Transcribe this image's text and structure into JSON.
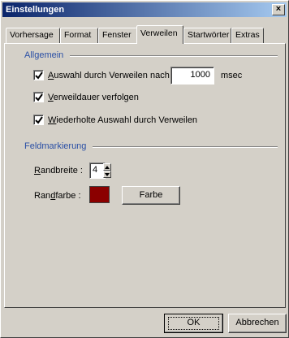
{
  "window": {
    "title": "Einstellungen",
    "close_symbol": "×"
  },
  "tabs": [
    {
      "label": "Vorhersage",
      "active": false
    },
    {
      "label": "Format",
      "active": false
    },
    {
      "label": "Fenster",
      "active": false
    },
    {
      "label": "Verweilen",
      "active": true
    },
    {
      "label": "Startwörter",
      "active": false
    },
    {
      "label": "Extras",
      "active": false
    }
  ],
  "allgemein": {
    "heading": "Allgemein",
    "dwell_select": {
      "label_first": "A",
      "label_rest": "uswahl durch Verweilen nach",
      "value": "1000",
      "unit": "msec",
      "checked": true
    },
    "track_dwell": {
      "label_first": "V",
      "label_rest": "erweildauer verfolgen",
      "checked": true
    },
    "repeat_select": {
      "label_first": "W",
      "label_rest": "iederholte Auswahl durch Verweilen",
      "checked": true
    }
  },
  "feldmarkierung": {
    "heading": "Feldmarkierung",
    "border_width": {
      "label_first": "R",
      "label_rest": "andbreite :",
      "value": "4"
    },
    "border_color": {
      "label_start": "Ran",
      "label_underlined": "d",
      "label_end": "farbe :",
      "color": "#8b0000",
      "button_label": "Farbe"
    }
  },
  "footer": {
    "ok_label": "OK",
    "cancel_label": "Abbrechen"
  }
}
